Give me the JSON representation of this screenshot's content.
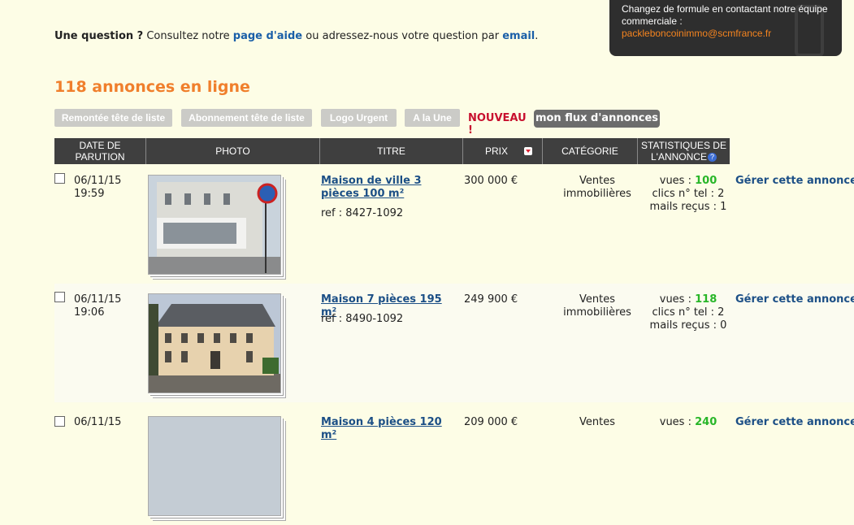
{
  "promo": {
    "message": "Changez de formule en contactant notre équipe commerciale :",
    "email": "packleboncoinimmo@scmfrance.fr"
  },
  "question": {
    "prefix": "Une question ?",
    "text1": " Consultez notre ",
    "help_link": "page d'aide",
    "text2": " ou adressez-nous votre question par ",
    "email_link": "email",
    "text3": "."
  },
  "ads_count": "118 annonces en ligne",
  "toolbar": {
    "buttons": [
      "Remontée tête de liste",
      "Abonnement tête de liste",
      "Logo Urgent",
      "A la Une"
    ],
    "nouveau": "NOUVEAU !",
    "flux": "mon flux d'annonces"
  },
  "table": {
    "headers": {
      "date": "DATE DE PARUTION",
      "photo": "PHOTO",
      "title": "TITRE",
      "price": "PRIX",
      "category": "CATÉGORIE",
      "stats": "STATISTIQUES DE L'ANNONCE"
    },
    "rows": [
      {
        "date": "06/11/15",
        "time": "19:59",
        "title": "Maison de ville 3 pièces 100 m²",
        "ref": "ref : 8427-1092",
        "price": "300 000 €",
        "cat1": "Ventes",
        "cat2": "immobilières",
        "views_label": "vues :",
        "views": "100",
        "calls": "clics n° tel : 2",
        "mails": "mails reçus : 1",
        "manage": "Gérer cette annonce"
      },
      {
        "date": "06/11/15",
        "time": "19:06",
        "title": "Maison 7 pièces 195 m²",
        "ref": "ref : 8490-1092",
        "price": "249 900 €",
        "cat1": "Ventes",
        "cat2": "immobilières",
        "views_label": "vues :",
        "views": "118",
        "calls": "clics n° tel : 2",
        "mails": "mails reçus : 0",
        "manage": "Gérer cette annonce"
      },
      {
        "date": "06/11/15",
        "time": "",
        "title": "Maison 4 pièces 120 m²",
        "ref": "",
        "price": "209 000 €",
        "cat1": "Ventes",
        "cat2": "",
        "views_label": "vues :",
        "views": "240",
        "calls": "",
        "mails": "",
        "manage": "Gérer cette annonce"
      }
    ]
  }
}
